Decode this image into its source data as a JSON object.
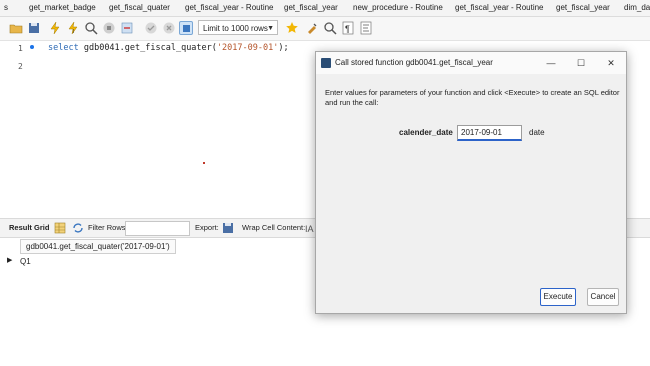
{
  "tabs": [
    "s",
    "get_market_badge",
    "get_fiscal_quater",
    "get_fiscal_year - Routine",
    "get_fiscal_year",
    "new_procedure - Routine",
    "get_fiscal_year - Routine",
    "get_fiscal_year",
    "dim_dat"
  ],
  "toolbar": {
    "limit_value": "Limit to 1000 rows"
  },
  "editor": {
    "line_numbers": [
      "1",
      "2"
    ],
    "code_keyword": "select",
    "code_function": "gdb0041.get_fiscal_quater(",
    "code_argument": "'2017-09-01'",
    "code_end": ");"
  },
  "result_bar": {
    "result_grid": "Result Grid",
    "filter_rows": "Filter Rows:",
    "export": "Export:",
    "wrap_cell": "Wrap Cell Content:"
  },
  "grid": {
    "column": "gdb0041.get_fiscal_quater('2017-09-01')",
    "rows": [
      "Q1"
    ]
  },
  "dialog": {
    "title": "Call stored function gdb0041.get_fiscal_year",
    "instructions": "Enter values for parameters of your function and click <Execute> to create an SQL editor and run the call:",
    "param_name": "calender_date",
    "param_value": "2017-09-01",
    "param_type": "date",
    "execute_label": "Execute",
    "cancel_label": "Cancel",
    "minimize": "—",
    "maximize": "☐",
    "close": "✕"
  }
}
